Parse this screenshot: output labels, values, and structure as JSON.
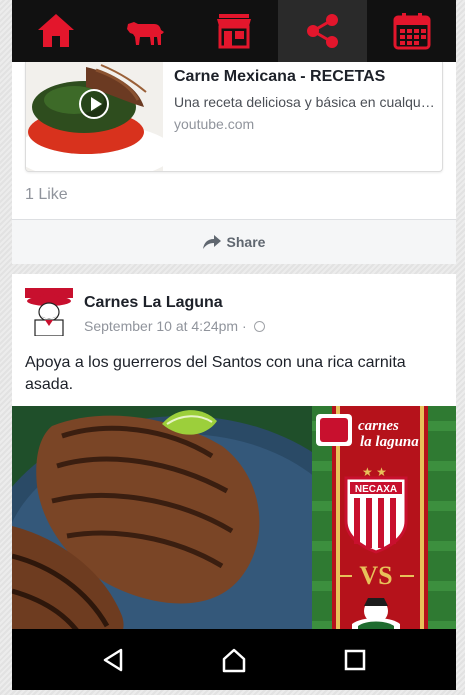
{
  "colors": {
    "accent": "#e3162c",
    "topbar_bg": "#111111",
    "navbar_bg": "#000000",
    "text_primary": "#1d2129",
    "text_secondary": "#90949c"
  },
  "top_tabs": [
    {
      "icon": "home-icon",
      "active": false
    },
    {
      "icon": "cow-icon",
      "active": false
    },
    {
      "icon": "store-icon",
      "active": false
    },
    {
      "icon": "share-icon",
      "active": true
    },
    {
      "icon": "calendar-icon",
      "active": false
    }
  ],
  "post1": {
    "link": {
      "title": "Carne Mexicana - RECETAS",
      "description": "Una receta deliciosa y básica en cualquier cocina mexicana",
      "domain": "youtube.com"
    },
    "likes": "1 Like",
    "share_label": "Share"
  },
  "post2": {
    "page_name": "Carnes La Laguna",
    "timestamp": "September 10 at 4:24pm · ",
    "text": "Apoya a los guerreros del Santos con una rica carnita asada.",
    "image": {
      "brand_text": "carnes la laguna",
      "team_badge": "NECAXA",
      "vs_text": "VS"
    }
  },
  "android_nav": [
    {
      "icon": "back-icon"
    },
    {
      "icon": "home-nav-icon"
    },
    {
      "icon": "recents-icon"
    }
  ]
}
